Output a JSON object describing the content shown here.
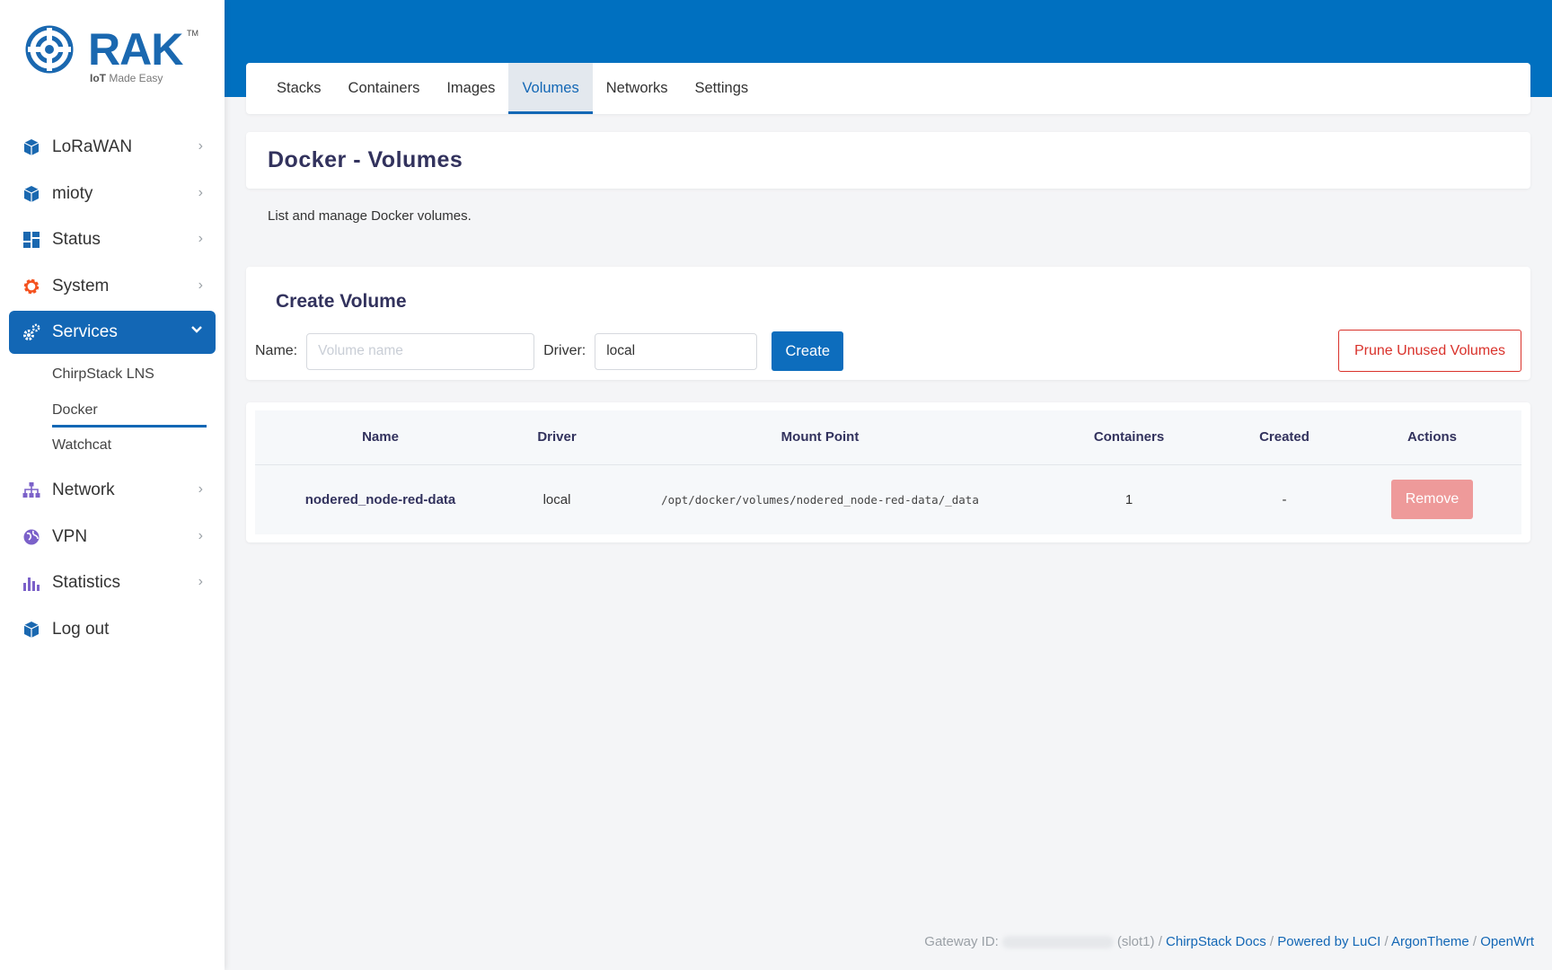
{
  "brand": {
    "name": "RAK",
    "tm": "TM",
    "tagline_bold": "IoT",
    "tagline_rest": " Made Easy"
  },
  "sidebar": {
    "items": [
      {
        "label": "LoRaWAN",
        "icon": "cube-icon",
        "color": "#1a68b0"
      },
      {
        "label": "mioty",
        "icon": "cube-icon",
        "color": "#1a68b0"
      },
      {
        "label": "Status",
        "icon": "dashboard-icon",
        "color": "#1a68b0"
      },
      {
        "label": "System",
        "icon": "gear-icon",
        "color": "#f4511e"
      },
      {
        "label": "Services",
        "icon": "cogs-icon",
        "color": "#ffffff"
      },
      {
        "label": "Network",
        "icon": "sitemap-icon",
        "color": "#7b61c9"
      },
      {
        "label": "VPN",
        "icon": "globe-icon",
        "color": "#7b61c9"
      },
      {
        "label": "Statistics",
        "icon": "bar-chart-icon",
        "color": "#7b61c9"
      },
      {
        "label": "Log out",
        "icon": "cube-icon",
        "color": "#1a68b0"
      }
    ],
    "services_sub": [
      {
        "label": "ChirpStack LNS"
      },
      {
        "label": "Docker"
      },
      {
        "label": "Watchcat"
      }
    ]
  },
  "tabs": [
    "Stacks",
    "Containers",
    "Images",
    "Volumes",
    "Networks",
    "Settings"
  ],
  "page": {
    "title": "Docker - Volumes",
    "description": "List and manage Docker volumes."
  },
  "create": {
    "title": "Create Volume",
    "name_label": "Name:",
    "name_placeholder": "Volume name",
    "driver_label": "Driver:",
    "driver_value": "local",
    "create_button": "Create",
    "prune_button": "Prune Unused Volumes"
  },
  "table": {
    "headers": [
      "Name",
      "Driver",
      "Mount Point",
      "Containers",
      "Created",
      "Actions"
    ],
    "rows": [
      {
        "name": "nodered_node-red-data",
        "driver": "local",
        "mount_point": "/opt/docker/volumes/nodered_node-red-data/_data",
        "containers": "1",
        "created": "-",
        "action": "Remove"
      }
    ]
  },
  "footer": {
    "gateway_label": "Gateway ID:",
    "slot": "(slot1)",
    "links": [
      "ChirpStack Docs",
      "Powered by LuCI",
      "ArgonTheme",
      "OpenWrt"
    ]
  },
  "colors": {
    "primary": "#0070c0",
    "danger": "#d9322b",
    "remove_bg": "#ee9a9a"
  }
}
